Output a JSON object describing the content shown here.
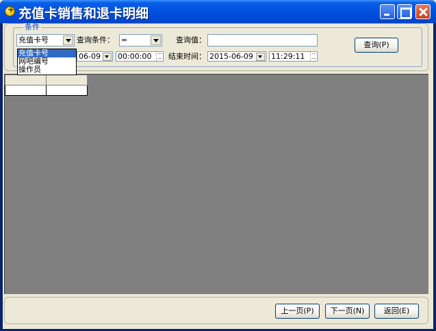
{
  "window": {
    "title": "充值卡销售和退卡明细"
  },
  "conditions": {
    "legend": "条件",
    "field_select": {
      "selected": "充值卡号",
      "options": [
        "充值卡号",
        "网吧编号",
        "操作员"
      ]
    },
    "query_condition_label": "查询条件：",
    "operator_value": "=",
    "query_value_label": "查询值：",
    "query_value": "",
    "start_date_partial": "06-09",
    "start_time": "00:00:00",
    "end_time_label": "结束时间：",
    "end_date": "2015-06-09",
    "end_time": "11:29:11",
    "query_button": "查询(P)"
  },
  "footer": {
    "prev_page_button": "上一页(P)",
    "next_page_button": "下一页(N)",
    "return_button": "返回(E)"
  },
  "colors": {
    "titlebar": "#0053E0",
    "face": "#ECE9D8",
    "grid_bg": "#808080",
    "selection": "#316AC5",
    "legend_text": "#0046D5"
  }
}
